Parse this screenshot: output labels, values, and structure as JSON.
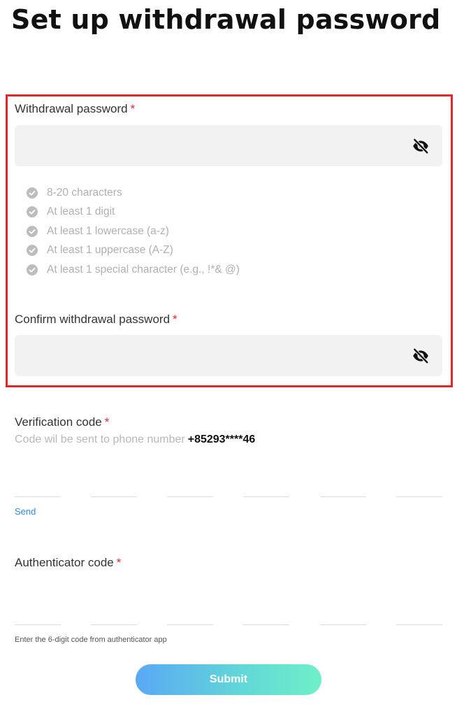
{
  "header": {
    "title": "Set up withdrawal password"
  },
  "password": {
    "label": "Withdrawal password",
    "required_mark": "*",
    "value": "",
    "rules": [
      "8-20 characters",
      "At least 1 digit",
      "At least 1 lowercase (a-z)",
      "At least 1 uppercase (A-Z)",
      "At least 1 special character (e.g., !*& @)"
    ]
  },
  "confirm": {
    "label": "Confirm withdrawal password",
    "required_mark": "*",
    "value": ""
  },
  "verification": {
    "label": "Verification code",
    "required_mark": "*",
    "hint": "Code wil be sent to phone number",
    "phone": "+85293****46",
    "send_label": "Send"
  },
  "authenticator": {
    "label": "Authenticator code",
    "required_mark": "*",
    "help": "Enter the 6-digit code from authenticator app"
  },
  "submit_label": "Submit",
  "colors": {
    "required": "#e3262a",
    "highlight_border": "#e3262a",
    "link": "#2f8be6",
    "submit_gradient_start": "#5aa8f5",
    "submit_gradient_end": "#6ff0c9"
  },
  "icons": {
    "password_visibility": "eye-off-icon",
    "rule_status": "check-circle-icon"
  }
}
